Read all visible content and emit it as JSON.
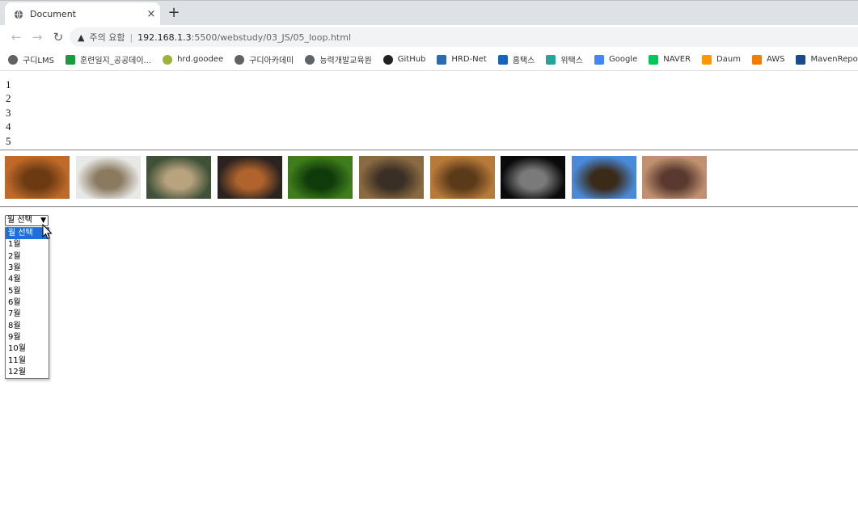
{
  "browser": {
    "tab_title": "Document",
    "tab_close": "×",
    "new_tab": "+",
    "security_text": "주의 요함",
    "url_host": "192.168.1.3",
    "url_path": ":5500/webstudy/03_JS/05_loop.html",
    "bookmarks": [
      {
        "label": "구디LMS",
        "icon": "globe-icon",
        "color": "#5f6368"
      },
      {
        "label": "훈련일지_공공데이...",
        "icon": "plus-square-icon",
        "color": "#1a9c3e"
      },
      {
        "label": "hrd.goodee",
        "icon": "leaf-icon",
        "color": "#9bb33a"
      },
      {
        "label": "구디아카데미",
        "icon": "globe-icon",
        "color": "#5f6368"
      },
      {
        "label": "능력개발교육원",
        "icon": "globe-icon",
        "color": "#5f6368"
      },
      {
        "label": "GitHub",
        "icon": "github-icon",
        "color": "#222222"
      },
      {
        "label": "HRD-Net",
        "icon": "hrd-icon",
        "color": "#2b6cb0"
      },
      {
        "label": "홈택스",
        "icon": "hometax-icon",
        "color": "#1565c0"
      },
      {
        "label": "위택스",
        "icon": "wetax-icon",
        "color": "#26a69a"
      },
      {
        "label": "Google",
        "icon": "google-icon",
        "color": "#4285f4"
      },
      {
        "label": "NAVER",
        "icon": "naver-icon",
        "color": "#03c75a"
      },
      {
        "label": "Daum",
        "icon": "daum-icon",
        "color": "#ff9800"
      },
      {
        "label": "AWS",
        "icon": "aws-icon",
        "color": "#f57c00"
      },
      {
        "label": "MavenRepository",
        "icon": "maven-icon",
        "color": "#1a4c8b"
      }
    ]
  },
  "page": {
    "numbers": [
      "1",
      "2",
      "3",
      "4",
      "5"
    ],
    "images": [
      {
        "name": "fox",
        "c1": "#c06a2a",
        "c2": "#6b3a12"
      },
      {
        "name": "hedgehog",
        "c1": "#e8e8e6",
        "c2": "#8a7a60"
      },
      {
        "name": "deer",
        "c1": "#3f5238",
        "c2": "#b9a27e"
      },
      {
        "name": "dog",
        "c1": "#2a2320",
        "c2": "#b0632c"
      },
      {
        "name": "frog",
        "c1": "#3f7d1c",
        "c2": "#0f3a0a"
      },
      {
        "name": "tiger",
        "c1": "#8a6a40",
        "c2": "#3a2f25"
      },
      {
        "name": "giraffe",
        "c1": "#b87a3a",
        "c2": "#5a3a18"
      },
      {
        "name": "lion",
        "c1": "#0a0a0a",
        "c2": "#7a7a7a"
      },
      {
        "name": "eagle",
        "c1": "#4a8ad8",
        "c2": "#3a2a18"
      },
      {
        "name": "cat",
        "c1": "#c09070",
        "c2": "#5a3a30"
      }
    ],
    "select": {
      "current": "월 선택",
      "options": [
        "월 선택",
        "1월",
        "2월",
        "3월",
        "4월",
        "5월",
        "6월",
        "7월",
        "8월",
        "9월",
        "10월",
        "11월",
        "12월"
      ],
      "highlighted_index": 0
    }
  }
}
